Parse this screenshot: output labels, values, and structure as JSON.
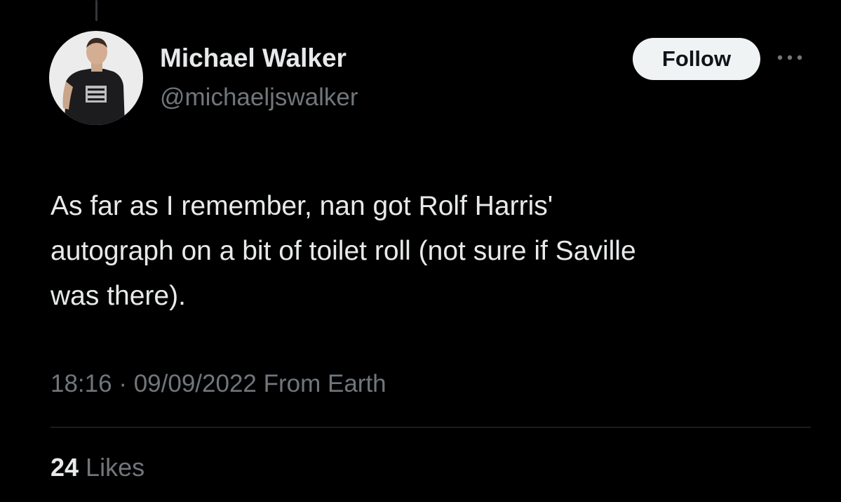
{
  "tweet": {
    "author": {
      "display_name": "Michael Walker",
      "handle": "@michaeljswalker",
      "avatar_icon": "profile-photo"
    },
    "follow_label": "Follow",
    "more_icon": "more-options-icon",
    "text": "As far as I remember, nan got Rolf Harris'\nautograph on a bit of toilet roll (not sure if Saville\nwas there).",
    "time": "18:16",
    "separator": " · ",
    "date": "09/09/2022",
    "source": " From Earth",
    "likes": {
      "count": "24",
      "label": " Likes"
    }
  },
  "colors": {
    "background": "#000000",
    "primary_text": "#e7e9ea",
    "secondary_text": "#71767b",
    "follow_button_bg": "#eff3f4",
    "divider": "#2f3336"
  }
}
